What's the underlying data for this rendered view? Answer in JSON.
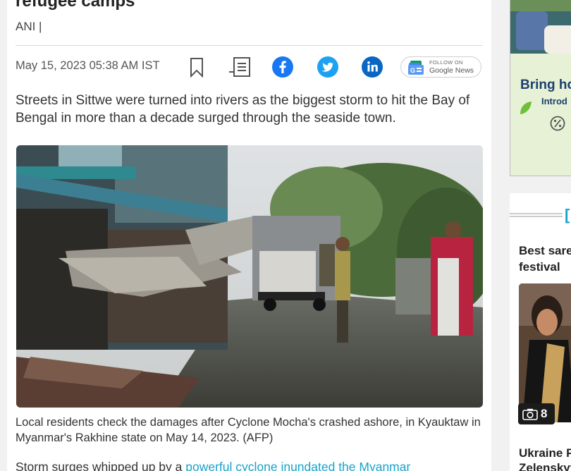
{
  "article": {
    "title_fragment": "refugee camps",
    "byline": "ANI |",
    "date": "May 15, 2023 05:38 AM IST",
    "google_news": {
      "follow": "FOLLOW ON",
      "name": "Google News"
    },
    "lead": "Streets in Sittwe were turned into rivers as the biggest storm to hit the Bay of Bengal in more than a decade surged through the seaside town.",
    "caption": "Local residents check the damages after Cyclone Mocha's crashed ashore, in Kyauktaw in Myanmar's Rakhine state on May 14, 2023. (AFP)",
    "body_prefix": "Storm surges whipped up by a ",
    "body_link": "powerful cyclone inundated the Myanmar"
  },
  "icons": [
    "bookmark-icon",
    "print-icon",
    "facebook-icon",
    "twitter-icon",
    "linkedin-icon",
    "google-news-icon",
    "camera-icon"
  ],
  "colors": {
    "facebook": "#1877f2",
    "twitter": "#1da1f2",
    "linkedin": "#0a66c2",
    "link": "#1aa3c9",
    "ad_blue": "#1d3f6e"
  },
  "ad": {
    "line1": "Bring ho",
    "line2": "Introd"
  },
  "sidebar": {
    "bracket": "[",
    "story1_title": [
      "Best sarec",
      "festival"
    ],
    "gallery_count": "8",
    "story2_title": [
      "Ukraine P",
      "Zelenskyy"
    ]
  }
}
